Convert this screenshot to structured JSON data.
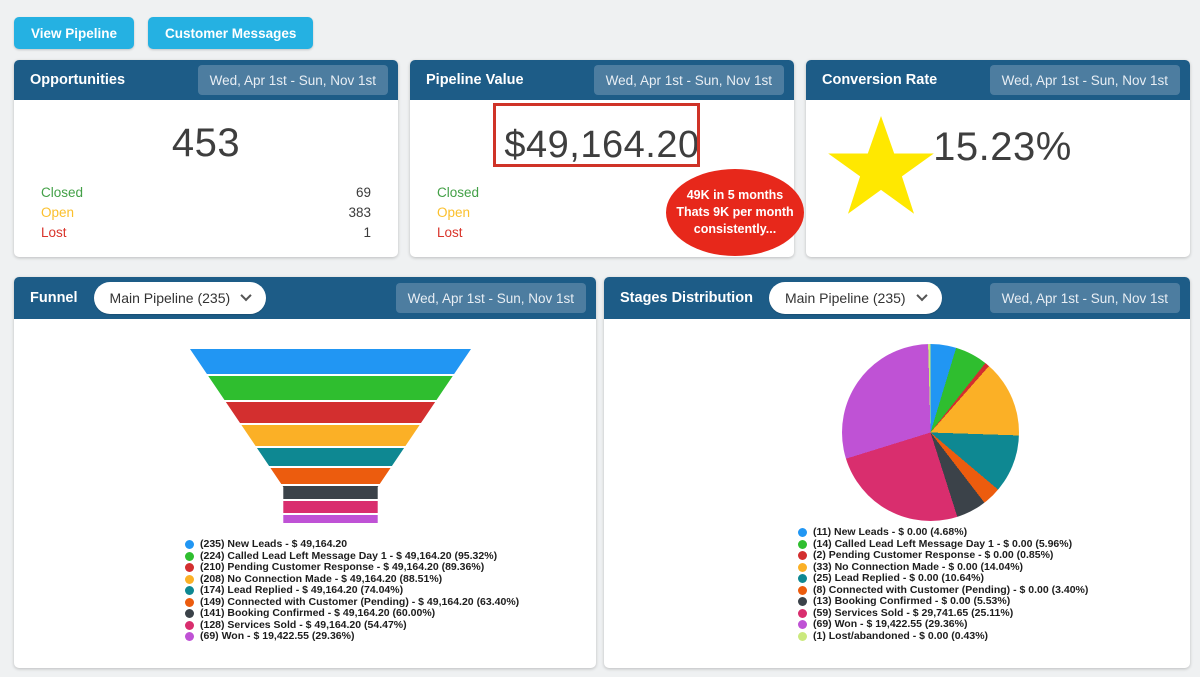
{
  "date_range": "Wed, Apr 1st - Sun, Nov 1st",
  "toolbar": {
    "view_pipeline": "View Pipeline",
    "customer_messages": "Customer Messages"
  },
  "opportunities": {
    "title": "Opportunities",
    "total": "453",
    "stats": [
      {
        "label": "Closed",
        "value": "69"
      },
      {
        "label": "Open",
        "value": "383"
      },
      {
        "label": "Lost",
        "value": "1"
      }
    ]
  },
  "pipeline_value": {
    "title": "Pipeline Value",
    "total": "$49,164.20",
    "stats": [
      {
        "label": "Closed",
        "value": ""
      },
      {
        "label": "Open",
        "value": ""
      },
      {
        "label": "Lost",
        "value": ""
      }
    ],
    "annotation_lines": [
      "49K in 5 months",
      "Thats 9K per month",
      "consistently..."
    ]
  },
  "conversion_rate": {
    "title": "Conversion Rate",
    "total": "15.23%"
  },
  "funnel_card": {
    "title": "Funnel",
    "selector": "Main Pipeline (235)"
  },
  "stages_card": {
    "title": "Stages Distribution",
    "selector": "Main Pipeline (235)"
  },
  "colors": {
    "page_bg": "#eff1f2",
    "header_bg": "#1d5c87",
    "chip_bg": "#4d7da0",
    "button_bg": "#25b1e2",
    "closed_green": "#43a047",
    "open_yellow": "#fbc02d",
    "lost_red": "#d9342b",
    "highlight_box_red": "#cf3327",
    "annotation_red": "#e7281b",
    "star_yellow": "#ffe800"
  },
  "chart_data": [
    {
      "type": "funnel",
      "title": "Funnel",
      "pipeline": "Main Pipeline (235)",
      "legend_position": "bottom",
      "stages": [
        {
          "count": 235,
          "label": "New Leads",
          "value": "$ 49,164.20",
          "pct": null,
          "color": "#2196f3",
          "text": "(235) New Leads - $ 49,164.20"
        },
        {
          "count": 224,
          "label": "Called Lead Left Message Day 1",
          "value": "$ 49,164.20",
          "pct": "95.32%",
          "color": "#2fbe2f",
          "text": "(224) Called Lead Left Message Day 1 - $ 49,164.20 (95.32%)"
        },
        {
          "count": 210,
          "label": "Pending Customer Response",
          "value": "$ 49,164.20",
          "pct": "89.36%",
          "color": "#d32f2f",
          "text": "(210) Pending Customer Response - $ 49,164.20 (89.36%)"
        },
        {
          "count": 208,
          "label": "No Connection Made",
          "value": "$ 49,164.20",
          "pct": "88.51%",
          "color": "#fbb026",
          "text": "(208) No Connection Made - $ 49,164.20 (88.51%)"
        },
        {
          "count": 174,
          "label": "Lead Replied",
          "value": "$ 49,164.20",
          "pct": "74.04%",
          "color": "#0e8892",
          "text": "(174) Lead Replied - $ 49,164.20 (74.04%)"
        },
        {
          "count": 149,
          "label": "Connected with Customer (Pending)",
          "value": "$ 49,164.20",
          "pct": "63.40%",
          "color": "#ec5c0e",
          "text": "(149) Connected with Customer (Pending) - $ 49,164.20 (63.40%)"
        },
        {
          "count": 141,
          "label": "Booking Confirmed",
          "value": "$ 49,164.20",
          "pct": "60.00%",
          "color": "#3b4249",
          "text": "(141) Booking Confirmed - $ 49,164.20 (60.00%)"
        },
        {
          "count": 128,
          "label": "Services Sold",
          "value": "$ 49,164.20",
          "pct": "54.47%",
          "color": "#d92e6e",
          "text": "(128) Services Sold - $ 49,164.20 (54.47%)"
        },
        {
          "count": 69,
          "label": "Won",
          "value": "$ 19,422.55",
          "pct": "29.36%",
          "color": "#bf52d5",
          "text": "(69) Won - $ 19,422.55 (29.36%)"
        }
      ]
    },
    {
      "type": "pie",
      "title": "Stages Distribution",
      "pipeline": "Main Pipeline (235)",
      "legend_position": "bottom",
      "slices": [
        {
          "count": 11,
          "label": "New Leads",
          "value": "$ 0.00",
          "pct": 4.68,
          "color": "#2196f3",
          "text": "(11) New Leads - $ 0.00 (4.68%)"
        },
        {
          "count": 14,
          "label": "Called Lead Left Message Day 1",
          "value": "$ 0.00",
          "pct": 5.96,
          "color": "#2fbe2f",
          "text": "(14) Called Lead Left Message Day 1 - $ 0.00 (5.96%)"
        },
        {
          "count": 2,
          "label": "Pending Customer Response",
          "value": "$ 0.00",
          "pct": 0.85,
          "color": "#d32f2f",
          "text": "(2) Pending Customer Response - $ 0.00 (0.85%)"
        },
        {
          "count": 33,
          "label": "No Connection Made",
          "value": "$ 0.00",
          "pct": 14.04,
          "color": "#fbb026",
          "text": "(33) No Connection Made - $ 0.00 (14.04%)"
        },
        {
          "count": 25,
          "label": "Lead Replied",
          "value": "$ 0.00",
          "pct": 10.64,
          "color": "#0e8892",
          "text": "(25) Lead Replied - $ 0.00 (10.64%)"
        },
        {
          "count": 8,
          "label": "Connected with Customer (Pending)",
          "value": "$ 0.00",
          "pct": 3.4,
          "color": "#ec5c0e",
          "text": "(8) Connected with Customer (Pending) - $ 0.00 (3.40%)"
        },
        {
          "count": 13,
          "label": "Booking Confirmed",
          "value": "$ 0.00",
          "pct": 5.53,
          "color": "#3b4249",
          "text": "(13) Booking Confirmed - $ 0.00 (5.53%)"
        },
        {
          "count": 59,
          "label": "Services Sold",
          "value": "$ 29,741.65",
          "pct": 25.11,
          "color": "#d92e6e",
          "text": "(59) Services Sold - $ 29,741.65 (25.11%)"
        },
        {
          "count": 69,
          "label": "Won",
          "value": "$ 19,422.55",
          "pct": 29.36,
          "color": "#bf52d5",
          "text": "(69) Won - $ 19,422.55 (29.36%)"
        },
        {
          "count": 1,
          "label": "Lost/abandoned",
          "value": "$ 0.00",
          "pct": 0.43,
          "color": "#cbe97d",
          "text": "(1) Lost/abandoned - $ 0.00 (0.43%)"
        }
      ]
    }
  ]
}
